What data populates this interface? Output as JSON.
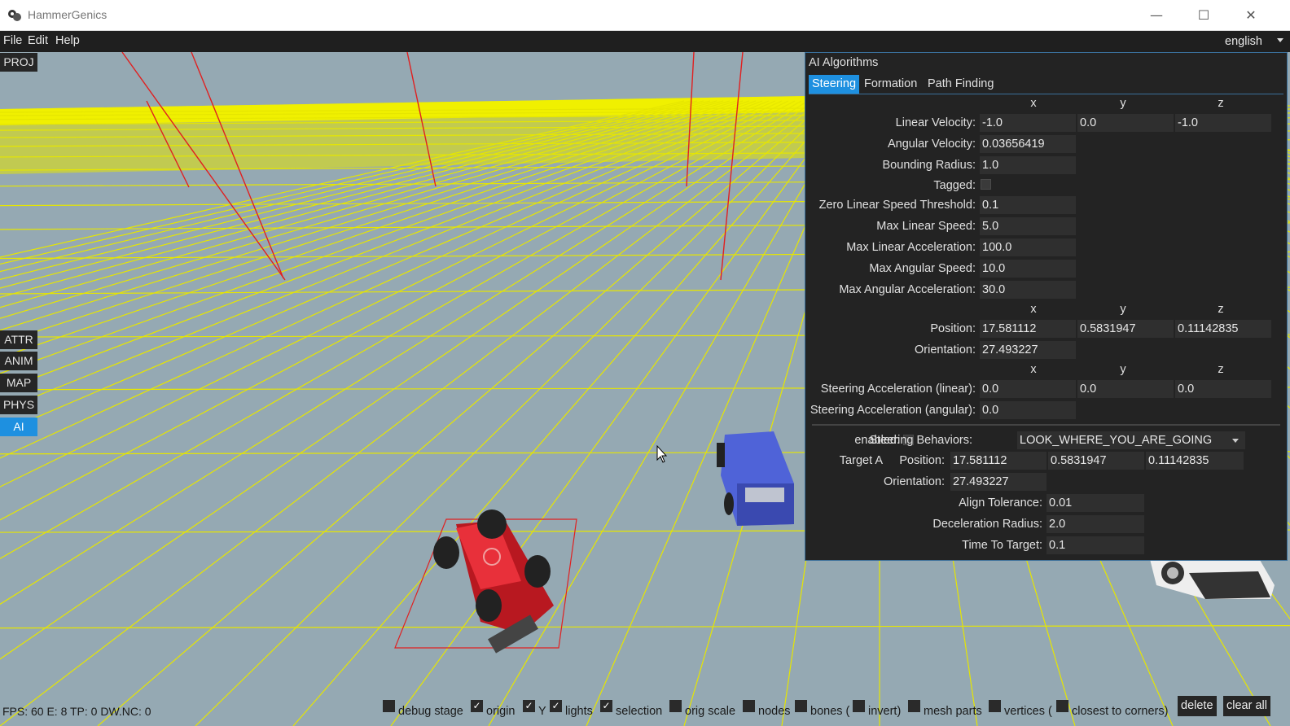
{
  "window": {
    "title": "HammerGenics",
    "minimize": "—",
    "maximize": "☐",
    "close": "✕"
  },
  "menu": {
    "items": [
      "File",
      "Edit",
      "Help"
    ],
    "language": "english"
  },
  "side_buttons": {
    "proj": "PROJ",
    "attr": "ATTR",
    "anim": "ANIM",
    "map": "MAP",
    "phys": "PHYS",
    "ai": "AI"
  },
  "ai_panel": {
    "title": "AI Algorithms",
    "tabs": [
      "Steering",
      "Formation",
      "Path Finding"
    ],
    "axis": {
      "x": "x",
      "y": "y",
      "z": "z"
    },
    "linear_velocity": {
      "label": "Linear Velocity:",
      "x": "-1.0",
      "y": "0.0",
      "z": "-1.0"
    },
    "angular_velocity": {
      "label": "Angular Velocity:",
      "value": "0.03656419"
    },
    "bounding_radius": {
      "label": "Bounding Radius:",
      "value": "1.0"
    },
    "tagged": {
      "label": "Tagged:",
      "checked": false
    },
    "zero_linear_speed_threshold": {
      "label": "Zero Linear Speed Threshold:",
      "value": "0.1"
    },
    "max_linear_speed": {
      "label": "Max Linear Speed:",
      "value": "5.0"
    },
    "max_linear_acceleration": {
      "label": "Max Linear Acceleration:",
      "value": "100.0"
    },
    "max_angular_speed": {
      "label": "Max Angular Speed:",
      "value": "10.0"
    },
    "max_angular_acceleration": {
      "label": "Max Angular Acceleration:",
      "value": "30.0"
    },
    "position": {
      "label": "Position:",
      "x": "17.581112",
      "y": "0.5831947",
      "z": "0.11142835"
    },
    "orientation": {
      "label": "Orientation:",
      "value": "27.493227"
    },
    "steering_linear": {
      "label": "Steering Acceleration (linear):",
      "x": "0.0",
      "y": "0.0",
      "z": "0.0"
    },
    "steering_angular": {
      "label": "Steering Acceleration (angular):",
      "value": "0.0"
    },
    "enabled": {
      "label": "enabled:",
      "checked": false
    },
    "steering_behaviors": {
      "label": "Steering Behaviors:",
      "selected": "LOOK_WHERE_YOU_ARE_GOING"
    },
    "target": {
      "name": "Target A",
      "position_label": "Position:",
      "x": "17.581112",
      "y": "0.5831947",
      "z": "0.11142835",
      "orientation_label": "Orientation:",
      "orientation": "27.493227"
    },
    "align_tolerance": {
      "label": "Align Tolerance:",
      "value": "0.01"
    },
    "deceleration_radius": {
      "label": "Deceleration Radius:",
      "value": "2.0"
    },
    "time_to_target": {
      "label": "Time To Target:",
      "value": "0.1"
    }
  },
  "status": {
    "text": "FPS: 60 E: 8 TP: 0 DW.NC: 0"
  },
  "options": [
    {
      "label": "debug stage",
      "checked": false
    },
    {
      "label": "origin",
      "checked": true
    },
    {
      "label": "Y",
      "checked": true
    },
    {
      "label": "lights",
      "checked": true
    },
    {
      "label": "selection",
      "checked": true
    },
    {
      "label": "orig scale",
      "checked": false
    },
    {
      "label": "nodes",
      "checked": false
    },
    {
      "label": "bones (",
      "checked": false
    },
    {
      "label": "invert)",
      "checked": false
    },
    {
      "label": "mesh parts",
      "checked": false
    },
    {
      "label": "vertices (",
      "checked": false
    },
    {
      "label": "closest to corners)",
      "checked": false
    }
  ],
  "buttons": {
    "delete": "delete",
    "clear_all": "clear all"
  },
  "colors": {
    "accent": "#1e90e0",
    "panel_bg": "#232323",
    "viewport_bg": "#95a9b3",
    "grid": "#e6e600"
  }
}
